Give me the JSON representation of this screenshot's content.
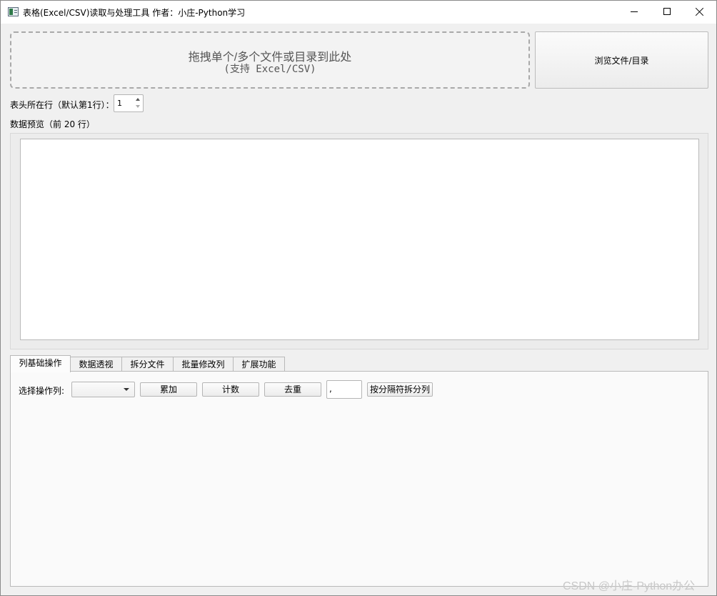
{
  "window": {
    "title": "表格(Excel/CSV)读取与处理工具 作者：小庄-Python学习",
    "icon": "spreadsheet-app-icon",
    "controls": [
      "minimize-icon",
      "maximize-icon",
      "close-icon"
    ]
  },
  "dropzone": {
    "line1": "拖拽单个/多个文件或目录到此处",
    "line2": "(支持 Excel/CSV)"
  },
  "browse_button": "浏览文件/目录",
  "header_row": {
    "label": "表头所在行（默认第1行）：",
    "value": "1"
  },
  "preview": {
    "label": "数据预览（前 20 行）"
  },
  "tabs": [
    {
      "label": "列基础操作",
      "active": true
    },
    {
      "label": "数据透视",
      "active": false
    },
    {
      "label": "拆分文件",
      "active": false
    },
    {
      "label": "批量修改列",
      "active": false
    },
    {
      "label": "扩展功能",
      "active": false
    }
  ],
  "column_ops": {
    "select_label": "选择操作列:",
    "select_value": "",
    "accumulate": "累加",
    "count": "计数",
    "dedupe": "去重",
    "separator_value": ",",
    "split_by_separator": "按分隔符拆分列"
  },
  "watermark": "CSDN @小庄-Python办公"
}
